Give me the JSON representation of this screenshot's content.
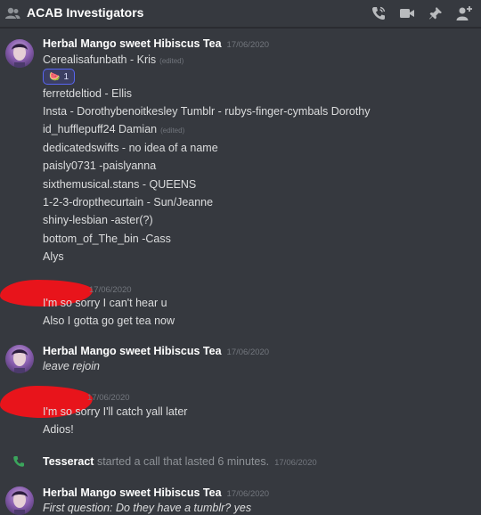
{
  "channel": {
    "name": "ACAB Investigators"
  },
  "messages": {
    "m1": {
      "author": "Herbal Mango sweet Hibiscus Tea",
      "timestamp": "17/06/2020",
      "lines": [
        "Cerealisafunbath - Kris",
        "ferretdeltiod - Ellis",
        "Insta - Dorothybenoitkesley Tumblr - rubys-finger-cymbals Dorothy",
        "id_hufflepuff24 Damian",
        "dedicatedswifts - no idea of a name",
        "paisly0731 -paislyanna",
        "sixthemusical.stans - QUEENS",
        "1-2-3-dropthecurtain - Sun/Jeanne",
        "shiny-lesbian -aster(?)",
        "bottom_of_The_bin -Cass",
        "Alys"
      ],
      "edited_label": "(edited)",
      "reaction": {
        "emoji": "🍉",
        "count": "1"
      }
    },
    "m2": {
      "timestamp": "17/06/2020",
      "lines": [
        "I'm so sorry I can't hear u",
        "Also I gotta go get tea now"
      ]
    },
    "m3": {
      "author": "Herbal Mango sweet Hibiscus Tea",
      "timestamp": "17/06/2020",
      "lines": [
        "leave rejoin"
      ]
    },
    "m4": {
      "timestamp": "17/06/2020",
      "lines": [
        "I'm so sorry I'll catch yall later",
        "Adios!"
      ]
    },
    "call": {
      "caller": "Tesseract",
      "text": "started a call that lasted 6 minutes.",
      "timestamp": "17/06/2020"
    },
    "m5": {
      "author": "Herbal Mango sweet Hibiscus Tea",
      "timestamp": "17/06/2020",
      "lines": [
        "First question: Do they have a tumblr? yes"
      ]
    }
  },
  "icons": {
    "header": [
      "people-icon",
      "call-icon",
      "video-icon",
      "pin-icon",
      "add-member-icon"
    ],
    "call": "phone-icon"
  },
  "colors": {
    "background": "#36393f",
    "text": "#dcddde",
    "muted": "#72767d",
    "call_green": "#3ba55c",
    "redaction": "#e8141b"
  }
}
